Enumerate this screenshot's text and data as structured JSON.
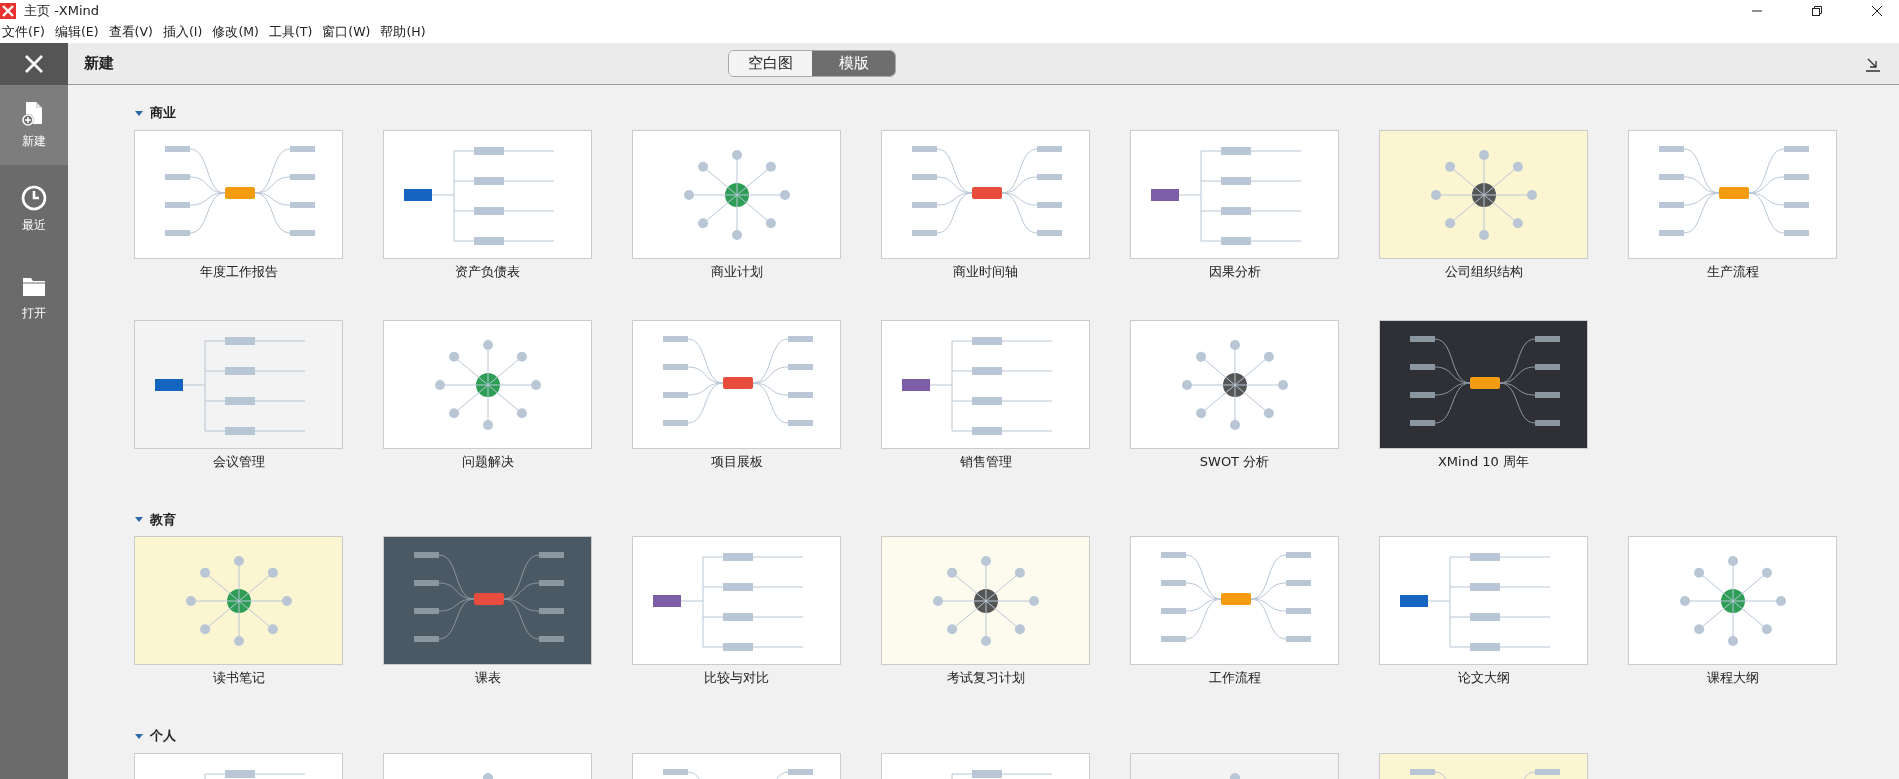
{
  "window": {
    "title": "主页 -XMind"
  },
  "menu": [
    "文件(F)",
    "编辑(E)",
    "查看(V)",
    "插入(I)",
    "修改(M)",
    "工具(T)",
    "窗口(W)",
    "帮助(H)"
  ],
  "sidebar": {
    "items": [
      {
        "label": "新建",
        "kind": "new",
        "selected": true
      },
      {
        "label": "最近",
        "kind": "recent",
        "selected": false
      },
      {
        "label": "打开",
        "kind": "open",
        "selected": false
      }
    ]
  },
  "header": {
    "title": "新建",
    "toggle": [
      {
        "label": "空白图",
        "selected": false
      },
      {
        "label": "模版",
        "selected": true
      }
    ]
  },
  "sections": [
    {
      "title": "商业",
      "expanded": true,
      "templates": [
        {
          "name": "年度工作报告",
          "kind": "light"
        },
        {
          "name": "资产负债表",
          "kind": "light"
        },
        {
          "name": "商业计划",
          "kind": "light"
        },
        {
          "name": "商业时间轴",
          "kind": "light"
        },
        {
          "name": "因果分析",
          "kind": "light"
        },
        {
          "name": "公司组织结构",
          "kind": "yellow"
        },
        {
          "name": "生产流程",
          "kind": "light"
        },
        {
          "name": "会议管理",
          "kind": "grey"
        },
        {
          "name": "问题解决",
          "kind": "light"
        },
        {
          "name": "项目展板",
          "kind": "light"
        },
        {
          "name": "销售管理",
          "kind": "light"
        },
        {
          "name": "SWOT 分析",
          "kind": "light"
        },
        {
          "name": "XMind 10 周年",
          "kind": "dark"
        }
      ]
    },
    {
      "title": "教育",
      "expanded": true,
      "templates": [
        {
          "name": "读书笔记",
          "kind": "yellow"
        },
        {
          "name": "课表",
          "kind": "slate"
        },
        {
          "name": "比较与对比",
          "kind": "light"
        },
        {
          "name": "考试复习计划",
          "kind": "cream"
        },
        {
          "name": "工作流程",
          "kind": "light"
        },
        {
          "name": "论文大纲",
          "kind": "light"
        },
        {
          "name": "课程大纲",
          "kind": "light"
        }
      ]
    },
    {
      "title": "个人",
      "expanded": true,
      "templates": [
        {
          "kind": "light"
        },
        {
          "kind": "light"
        },
        {
          "kind": "light"
        },
        {
          "kind": "light"
        },
        {
          "kind": "grey"
        },
        {
          "kind": "yellow"
        }
      ]
    }
  ]
}
